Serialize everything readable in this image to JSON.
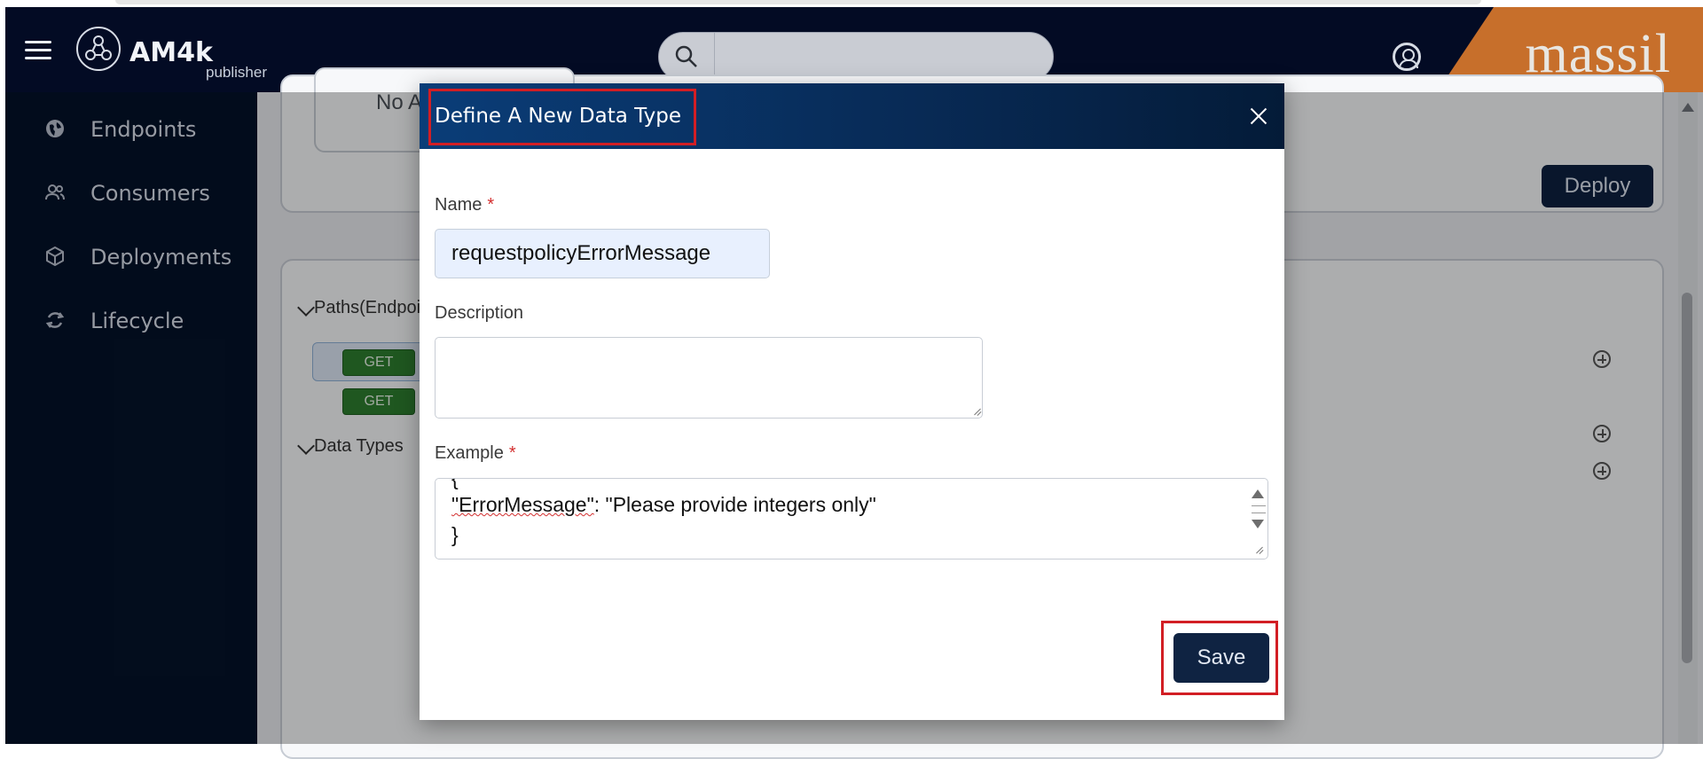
{
  "header": {
    "logo_text": "AM4k",
    "logo_sub": "publisher",
    "brand": "massil",
    "search_placeholder": ""
  },
  "sidebar": {
    "items": [
      {
        "label": "Endpoints",
        "icon": "globe-icon"
      },
      {
        "label": "Consumers",
        "icon": "users-icon"
      },
      {
        "label": "Deployments",
        "icon": "cube-icon"
      },
      {
        "label": "Lifecycle",
        "icon": "cycle-icon"
      }
    ]
  },
  "background": {
    "no_a_text": "No A",
    "deploy_label": "Deploy",
    "paths_label": "Paths(Endpoi",
    "get1": "GET",
    "get2": "GET",
    "data_types_label": "Data Types"
  },
  "modal": {
    "title": "Define A New Data Type",
    "name_label": "Name",
    "required_mark": "*",
    "name_value": "requestpolicyErrorMessage",
    "description_label": "Description",
    "description_value": "",
    "example_label": "Example",
    "example_lines": {
      "open": "{",
      "key": "\"ErrorMessage\"",
      "rest": ": \"Please provide integers only\"",
      "close": "}"
    },
    "save_label": "Save"
  },
  "colors": {
    "header_bg": "#030b24",
    "brand_orange": "#c76f2b",
    "sidebar_bg": "#041229",
    "highlight_red": "#d21e24",
    "get_green": "#2d7d2e",
    "button_navy": "#0f2342"
  }
}
